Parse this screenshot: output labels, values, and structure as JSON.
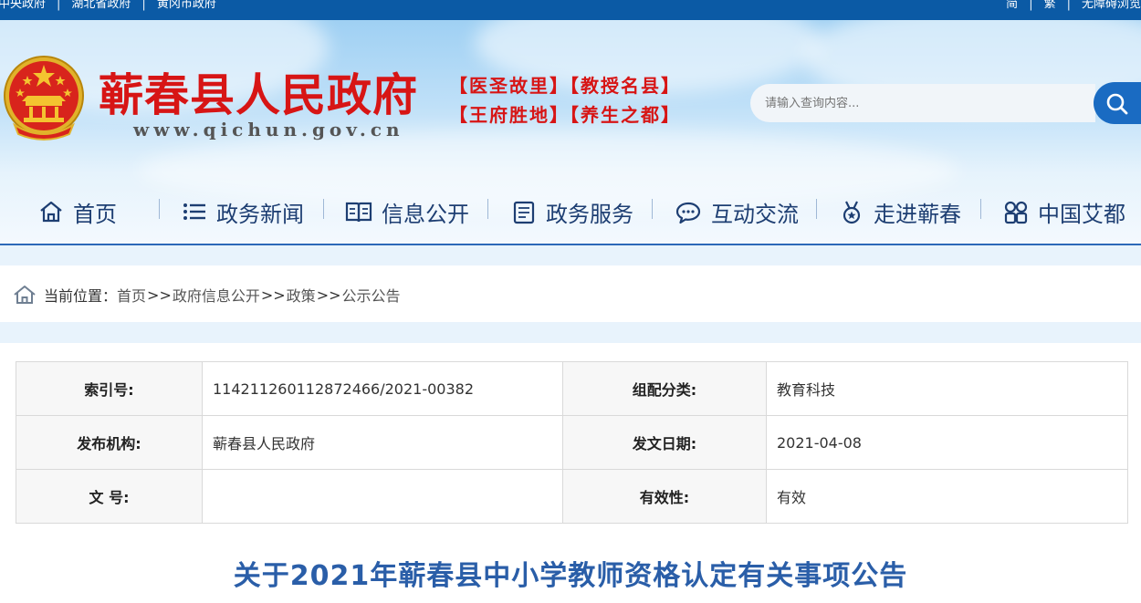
{
  "topbar": {
    "links": [
      "中央政府",
      "湖北省政府",
      "黄冈市政府"
    ],
    "tools": [
      "简",
      "繁",
      "无障碍浏览"
    ]
  },
  "header": {
    "title": "蕲春县人民政府",
    "url": "www.qichun.gov.cn",
    "slogans": [
      "【医圣故里】【教授名县】",
      "【王府胜地】【养生之都】"
    ],
    "search_placeholder": "请输入查询内容..."
  },
  "nav": {
    "items": [
      {
        "label": "首页",
        "icon": "home-icon"
      },
      {
        "label": "政务新闻",
        "icon": "list-icon"
      },
      {
        "label": "信息公开",
        "icon": "book-icon"
      },
      {
        "label": "政务服务",
        "icon": "document-icon"
      },
      {
        "label": "互动交流",
        "icon": "chat-icon"
      },
      {
        "label": "走进蕲春",
        "icon": "medal-icon"
      },
      {
        "label": "中国艾都",
        "icon": "grid-icon"
      }
    ]
  },
  "breadcrumb": {
    "prefix": "当前位置：",
    "items": [
      "首页",
      "政府信息公开",
      "政策",
      "公示公告"
    ],
    "separator": ">>"
  },
  "info": {
    "index_label": "索引号:",
    "index_value": "114211260112872466/2021-00382",
    "category_label": "组配分类:",
    "category_value": "教育科技",
    "publisher_label": "发布机构:",
    "publisher_value": "蕲春县人民政府",
    "date_label": "发文日期:",
    "date_value": "2021-04-08",
    "docno_label": "文 号:",
    "docno_value": "",
    "validity_label": "有效性:",
    "validity_value": "有效"
  },
  "article": {
    "title": "关于2021年蕲春县中小学教师资格认定有关事项公告"
  },
  "colors": {
    "topbar": "#0b5aa5",
    "title_red": "#d71515",
    "nav_text": "#1d3e72",
    "article_title": "#2a5ea8",
    "search_button": "#1a6bc2"
  }
}
